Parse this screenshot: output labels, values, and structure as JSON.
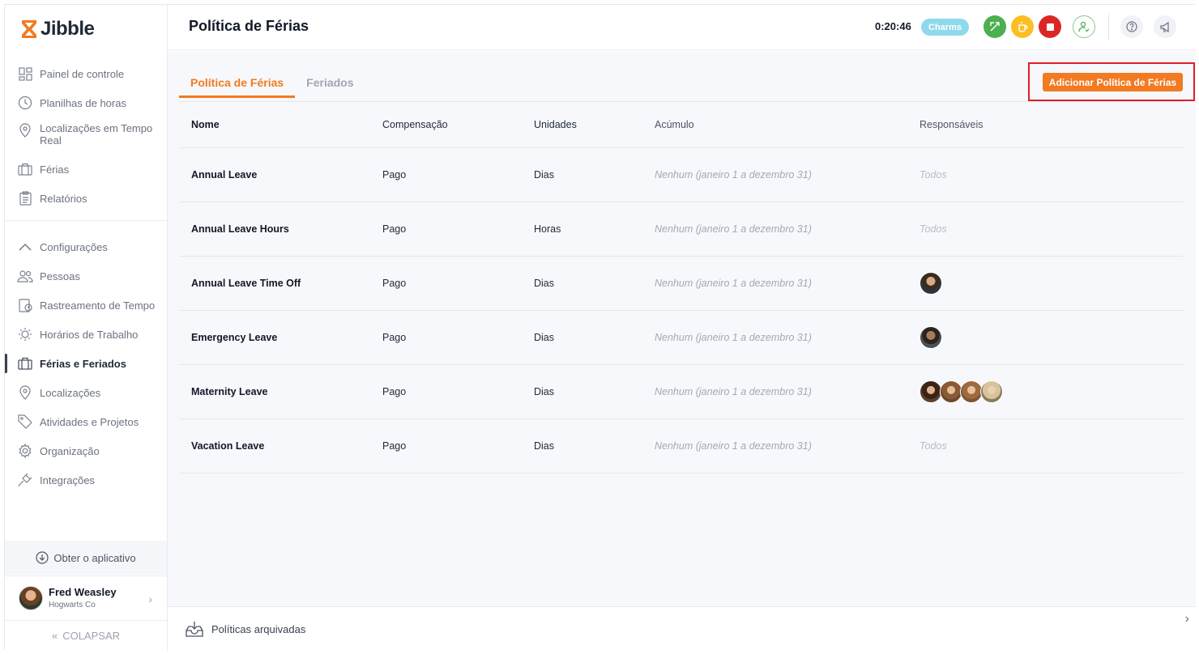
{
  "brand": {
    "name": "Jibble",
    "accent": "#f27a21"
  },
  "sidebar": {
    "items": [
      {
        "label": "Painel de controle",
        "icon": "dashboard-icon"
      },
      {
        "label": "Planilhas de horas",
        "icon": "clock-icon"
      },
      {
        "label": "Localizações em Tempo Real",
        "icon": "location-pin-icon"
      },
      {
        "label": "Férias",
        "icon": "briefcase-icon"
      },
      {
        "label": "Relatórios",
        "icon": "clipboard-icon"
      }
    ],
    "settings_label": "Configurações",
    "settings_items": [
      {
        "label": "Pessoas",
        "icon": "people-icon"
      },
      {
        "label": "Rastreamento de Tempo",
        "icon": "time-tracking-icon"
      },
      {
        "label": "Horários de Trabalho",
        "icon": "sun-schedule-icon"
      },
      {
        "label": "Férias e Feriados",
        "icon": "briefcase-icon",
        "active": true
      },
      {
        "label": "Localizações",
        "icon": "location-pin-icon"
      },
      {
        "label": "Atividades e Projetos",
        "icon": "tag-icon"
      },
      {
        "label": "Organização",
        "icon": "gear-icon"
      },
      {
        "label": "Integrações",
        "icon": "plug-icon"
      }
    ],
    "get_app_label": "Obter o aplicativo",
    "user": {
      "name": "Fred Weasley",
      "org": "Hogwarts Co"
    },
    "collapse_label": "COLAPSAR"
  },
  "header": {
    "title": "Política de Férias",
    "timer": "0:20:46",
    "badge": "Charms"
  },
  "main": {
    "tabs": [
      {
        "label": "Política de Férias",
        "active": true
      },
      {
        "label": "Feriados",
        "active": false
      }
    ],
    "add_button_label": "Adicionar Política de Férias",
    "columns": [
      "Nome",
      "Compensação",
      "Unidades",
      "Acúmulo",
      "Responsáveis"
    ],
    "rows": [
      {
        "name": "Annual Leave",
        "comp": "Pago",
        "units": "Dias",
        "accrual": "Nenhum (janeiro 1 a dezembro 31)",
        "assignees": "Todos"
      },
      {
        "name": "Annual Leave Hours",
        "comp": "Pago",
        "units": "Horas",
        "accrual": "Nenhum (janeiro 1 a dezembro 31)",
        "assignees": "Todos"
      },
      {
        "name": "Annual Leave Time Off",
        "comp": "Pago",
        "units": "Dias",
        "accrual": "Nenhum (janeiro 1 a dezembro 31)",
        "assignees": ""
      },
      {
        "name": "Emergency Leave",
        "comp": "Pago",
        "units": "Dias",
        "accrual": "Nenhum (janeiro 1 a dezembro 31)",
        "assignees": ""
      },
      {
        "name": "Maternity Leave",
        "comp": "Pago",
        "units": "Dias",
        "accrual": "Nenhum (janeiro 1 a dezembro 31)",
        "assignees": ""
      },
      {
        "name": "Vacation Leave",
        "comp": "Pago",
        "units": "Dias",
        "accrual": "Nenhum (janeiro 1 a dezembro 31)",
        "assignees": "Todos"
      }
    ]
  },
  "footer": {
    "archived_label": "Políticas arquivadas"
  }
}
